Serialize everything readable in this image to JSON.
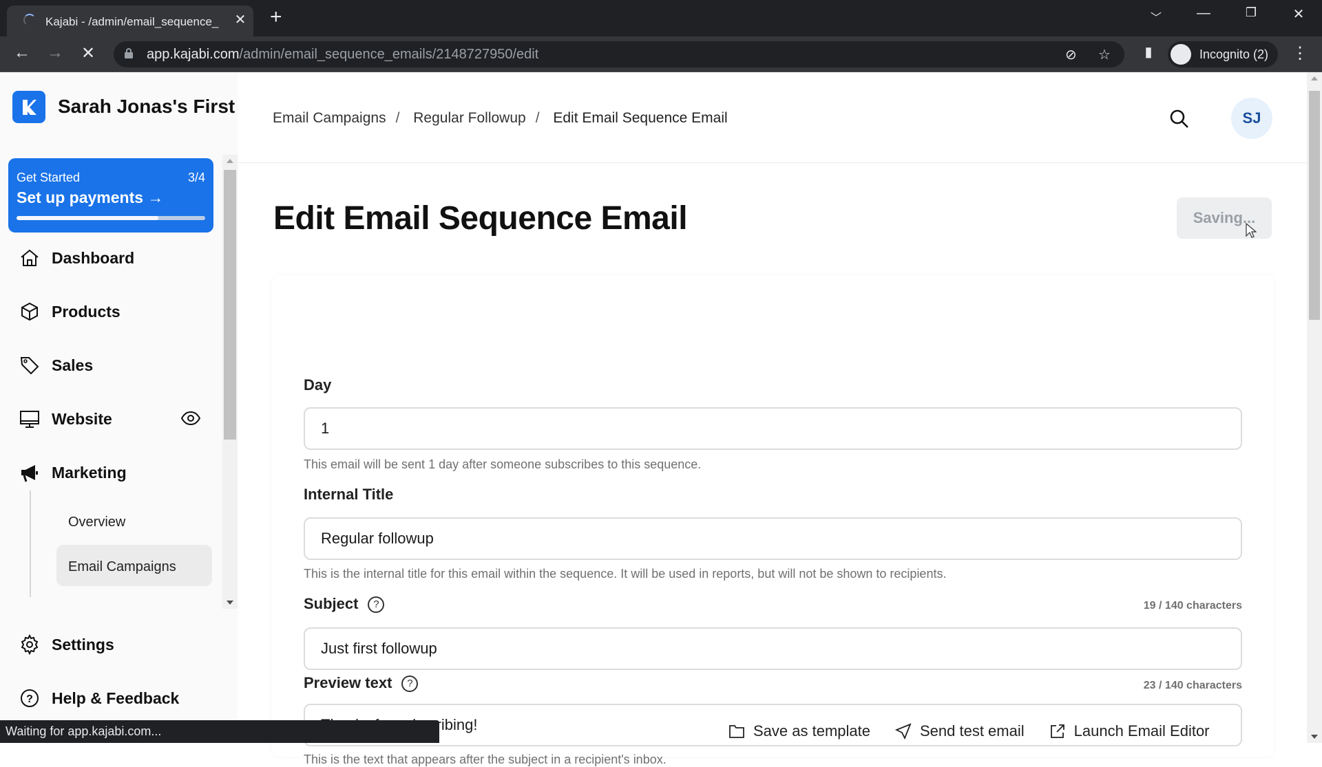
{
  "browser": {
    "tab_title": "Kajabi - /admin/email_sequence_",
    "url_host": "app.kajabi.com",
    "url_path": "/admin/email_sequence_emails/2148727950/edit",
    "profile_label": "Incognito (2)",
    "status_text": "Waiting for app.kajabi.com..."
  },
  "sidebar": {
    "brand_name": "Sarah Jonas's First",
    "get_started": {
      "label": "Get Started",
      "step": "3/4",
      "action": "Set up payments",
      "progress": 0.75
    },
    "items": [
      {
        "label": "Dashboard",
        "icon": "home-icon"
      },
      {
        "label": "Products",
        "icon": "box-icon"
      },
      {
        "label": "Sales",
        "icon": "tag-icon"
      },
      {
        "label": "Website",
        "icon": "monitor-icon"
      },
      {
        "label": "Marketing",
        "icon": "megaphone-icon"
      }
    ],
    "marketing_sub": [
      {
        "label": "Overview",
        "active": false
      },
      {
        "label": "Email Campaigns",
        "active": true
      }
    ],
    "bottom_items": [
      {
        "label": "Settings",
        "icon": "gear-icon"
      },
      {
        "label": "Help & Feedback",
        "icon": "help-icon"
      }
    ]
  },
  "header": {
    "breadcrumb": [
      "Email Campaigns",
      "Regular Followup",
      "Edit Email Sequence Email"
    ],
    "avatar_initials": "SJ"
  },
  "main": {
    "title": "Edit Email Sequence Email",
    "saving_label": "Saving...",
    "fields": {
      "day": {
        "label": "Day",
        "value": "1",
        "help": "This email will be sent 1 day after someone subscribes to this sequence."
      },
      "internal_title": {
        "label": "Internal Title",
        "value": "Regular followup",
        "help": "This is the internal title for this email within the sequence. It will be used in reports, but will not be shown to recipients."
      },
      "subject": {
        "label": "Subject",
        "value": "Just first followup",
        "counter": "19 / 140 characters"
      },
      "preview_text": {
        "label": "Preview text",
        "value": "Thanks for subscribing!",
        "counter": "23 / 140 characters",
        "help": "This is the text that appears after the subject in a recipient's inbox."
      }
    },
    "actions": {
      "save_template": "Save as template",
      "send_test": "Send test email",
      "launch_editor": "Launch Email Editor"
    }
  },
  "colors": {
    "accent": "#1a73e8",
    "avatar_bg": "#e6f1fc",
    "avatar_text": "#1c4f9c"
  }
}
